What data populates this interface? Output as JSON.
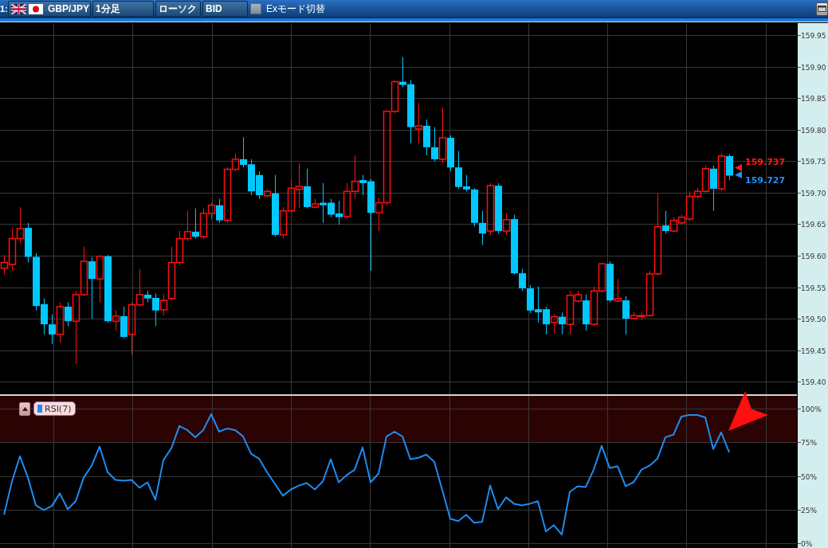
{
  "toolbar": {
    "pane_label": "1:",
    "selectors": [
      {
        "kind": "symbol",
        "label": "GBP/JPY"
      },
      {
        "kind": "plain",
        "label": "1分足"
      },
      {
        "kind": "plain",
        "label": "ローソク"
      },
      {
        "kind": "plain",
        "label": "BID"
      }
    ],
    "ex_mode": {
      "label": "Exモード切替",
      "checked": false
    }
  },
  "price_chart": {
    "chart_data": {
      "type": "candlestick",
      "grid": true,
      "ylim": [
        159.38,
        159.969
      ],
      "yticks": [
        {
          "value": 159.95,
          "label": "159.95"
        },
        {
          "value": 159.9,
          "label": "159.90"
        },
        {
          "value": 159.85,
          "label": "159.85"
        },
        {
          "value": 159.8,
          "label": "159.80"
        },
        {
          "value": 159.75,
          "label": "159.75"
        },
        {
          "value": 159.7,
          "label": "159.70"
        },
        {
          "value": 159.65,
          "label": "159.65"
        },
        {
          "value": 159.6,
          "label": "159.60"
        },
        {
          "value": 159.55,
          "label": "159.55"
        },
        {
          "value": 159.5,
          "label": "159.50"
        },
        {
          "value": 159.45,
          "label": "159.45"
        },
        {
          "value": 159.4,
          "label": "159.40"
        }
      ],
      "categories": [
        null,
        null,
        null,
        null,
        null,
        null,
        null,
        null,
        null,
        null,
        null,
        null,
        null,
        null,
        null,
        null,
        null,
        null,
        null,
        null,
        null,
        null,
        null,
        null,
        null,
        null,
        null,
        null,
        null,
        null,
        null,
        null,
        null,
        null,
        null,
        null,
        null,
        null,
        null,
        null,
        null,
        null,
        null,
        null,
        null,
        null,
        null,
        null,
        null,
        null,
        null,
        null,
        null,
        null,
        null,
        null,
        null,
        null,
        null,
        null,
        null,
        null,
        null,
        null,
        null,
        null,
        null,
        null,
        null,
        null,
        null,
        null,
        null,
        null,
        null,
        null,
        null,
        null,
        null,
        null,
        null,
        null,
        null,
        null,
        null,
        null,
        null,
        null,
        null,
        null,
        null,
        null,
        null,
        null,
        null,
        null,
        null,
        null,
        null,
        null
      ],
      "ohlc": [
        [
          159.58,
          159.601,
          159.57,
          159.589
        ],
        [
          159.586,
          159.642,
          159.576,
          159.627
        ],
        [
          159.627,
          159.677,
          159.62,
          159.643
        ],
        [
          159.644,
          159.652,
          159.589,
          159.598
        ],
        [
          159.598,
          159.604,
          159.513,
          159.52
        ],
        [
          159.523,
          159.532,
          159.475,
          159.491
        ],
        [
          159.491,
          159.507,
          159.46,
          159.475
        ],
        [
          159.475,
          159.526,
          159.462,
          159.519
        ],
        [
          159.519,
          159.526,
          159.488,
          159.496
        ],
        [
          159.496,
          159.544,
          159.428,
          159.538
        ],
        [
          159.538,
          159.614,
          159.536,
          159.591
        ],
        [
          159.591,
          159.598,
          159.5,
          159.563
        ],
        [
          159.563,
          159.601,
          159.526,
          159.599
        ],
        [
          159.599,
          159.601,
          159.494,
          159.496
        ],
        [
          159.496,
          159.513,
          159.481,
          159.504
        ],
        [
          159.504,
          159.519,
          159.469,
          159.471
        ],
        [
          159.475,
          159.526,
          159.443,
          159.522
        ],
        [
          159.522,
          159.579,
          159.519,
          159.538
        ],
        [
          159.538,
          159.544,
          159.526,
          159.532
        ],
        [
          159.533,
          159.54,
          159.488,
          159.513
        ],
        [
          159.514,
          159.539,
          159.505,
          159.529
        ],
        [
          159.532,
          159.614,
          159.529,
          159.589
        ],
        [
          159.589,
          159.639,
          159.585,
          159.627
        ],
        [
          159.627,
          159.671,
          159.623,
          159.638
        ],
        [
          159.638,
          159.675,
          159.627,
          159.63
        ],
        [
          159.63,
          159.675,
          159.627,
          159.667
        ],
        [
          159.667,
          159.684,
          159.658,
          159.68
        ],
        [
          159.68,
          159.69,
          159.652,
          159.656
        ],
        [
          159.656,
          159.74,
          159.652,
          159.737
        ],
        [
          159.737,
          159.762,
          159.734,
          159.753
        ],
        [
          159.753,
          159.788,
          159.74,
          159.744
        ],
        [
          159.745,
          159.753,
          159.696,
          159.702
        ],
        [
          159.728,
          159.734,
          159.69,
          159.696
        ],
        [
          159.695,
          159.705,
          159.692,
          159.702
        ],
        [
          159.699,
          159.728,
          159.63,
          159.633
        ],
        [
          159.633,
          159.677,
          159.627,
          159.671
        ],
        [
          159.671,
          159.721,
          159.667,
          159.707
        ],
        [
          159.705,
          159.747,
          159.675,
          159.71
        ],
        [
          159.71,
          159.738,
          159.675,
          159.677
        ],
        [
          159.677,
          159.69,
          159.675,
          159.682
        ],
        [
          159.684,
          159.715,
          159.652,
          159.68
        ],
        [
          159.684,
          159.69,
          159.661,
          159.665
        ],
        [
          159.667,
          159.687,
          159.649,
          159.661
        ],
        [
          159.662,
          159.715,
          159.658,
          159.702
        ],
        [
          159.702,
          159.759,
          159.69,
          159.718
        ],
        [
          159.72,
          159.728,
          159.696,
          159.715
        ],
        [
          159.718,
          159.721,
          159.576,
          159.668
        ],
        [
          159.668,
          159.692,
          159.639,
          159.684
        ],
        [
          159.684,
          159.831,
          159.68,
          159.829
        ],
        [
          159.829,
          159.879,
          159.826,
          159.876
        ],
        [
          159.876,
          159.915,
          159.867,
          159.871
        ],
        [
          159.872,
          159.879,
          159.778,
          159.804
        ],
        [
          159.801,
          159.842,
          159.778,
          159.806
        ],
        [
          159.806,
          159.816,
          159.759,
          159.772
        ],
        [
          159.772,
          159.804,
          159.75,
          159.753
        ],
        [
          159.753,
          159.835,
          159.747,
          159.787
        ],
        [
          159.787,
          159.791,
          159.734,
          159.74
        ],
        [
          159.74,
          159.766,
          159.706,
          159.709
        ],
        [
          159.71,
          159.728,
          159.702,
          159.705
        ],
        [
          159.705,
          159.707,
          159.646,
          159.652
        ],
        [
          159.652,
          159.671,
          159.617,
          159.635
        ],
        [
          159.639,
          159.715,
          159.633,
          159.711
        ],
        [
          159.711,
          159.715,
          159.635,
          159.639
        ],
        [
          159.639,
          159.667,
          159.633,
          159.657
        ],
        [
          159.658,
          159.665,
          159.57,
          159.572
        ],
        [
          159.572,
          159.579,
          159.544,
          159.548
        ],
        [
          159.548,
          159.553,
          159.509,
          159.513
        ],
        [
          159.515,
          159.551,
          159.494,
          159.51
        ],
        [
          159.515,
          159.519,
          159.475,
          159.491
        ],
        [
          159.494,
          159.507,
          159.477,
          159.503
        ],
        [
          159.503,
          159.51,
          159.475,
          159.491
        ],
        [
          159.491,
          159.544,
          159.475,
          159.537
        ],
        [
          159.528,
          159.544,
          159.526,
          159.538
        ],
        [
          159.529,
          159.538,
          159.481,
          159.491
        ],
        [
          159.491,
          159.551,
          159.488,
          159.544
        ],
        [
          159.544,
          159.589,
          159.541,
          159.587
        ],
        [
          159.587,
          159.591,
          159.526,
          159.529
        ],
        [
          159.528,
          159.563,
          159.526,
          159.532
        ],
        [
          159.529,
          159.536,
          159.475,
          159.5
        ],
        [
          159.5,
          159.51,
          159.498,
          159.505
        ],
        [
          159.503,
          159.51,
          159.498,
          159.505
        ],
        [
          159.505,
          159.576,
          159.503,
          159.571
        ],
        [
          159.571,
          159.699,
          159.568,
          159.646
        ],
        [
          159.648,
          159.671,
          159.635,
          159.639
        ],
        [
          159.639,
          159.661,
          159.637,
          159.656
        ],
        [
          159.652,
          159.665,
          159.649,
          159.661
        ],
        [
          159.658,
          159.702,
          159.654,
          159.694
        ],
        [
          159.694,
          159.707,
          159.69,
          159.702
        ],
        [
          159.702,
          159.743,
          159.7,
          159.738
        ],
        [
          159.738,
          159.743,
          159.671,
          159.706
        ],
        [
          159.706,
          159.763,
          159.702,
          159.758
        ],
        [
          159.758,
          159.761,
          159.72,
          159.727
        ],
        null,
        null,
        null,
        null,
        null,
        null,
        null,
        null
      ]
    },
    "price_markers": [
      {
        "label": "159.737",
        "color": "#ff1a1a"
      },
      {
        "label": "159.727",
        "color": "#1e90ff"
      }
    ]
  },
  "rsi_panel": {
    "chart_data": {
      "type": "line",
      "grid": true,
      "ylim": [
        -3.5,
        109.5
      ],
      "yticks": [
        {
          "value": 100,
          "label": "100%"
        },
        {
          "value": 75,
          "label": "75%"
        },
        {
          "value": 50,
          "label": "50%"
        },
        {
          "value": 25,
          "label": "25%"
        },
        {
          "value": 0,
          "label": "0%"
        }
      ],
      "categories": [
        null,
        null,
        null,
        null,
        null,
        null,
        null,
        null,
        null,
        null,
        null,
        null,
        null,
        null,
        null,
        null,
        null,
        null,
        null,
        null,
        null,
        null,
        null,
        null,
        null,
        null,
        null,
        null,
        null,
        null,
        null,
        null,
        null,
        null,
        null,
        null,
        null,
        null,
        null,
        null,
        null,
        null,
        null,
        null,
        null,
        null,
        null,
        null,
        null,
        null,
        null,
        null,
        null,
        null,
        null,
        null,
        null,
        null,
        null,
        null,
        null,
        null,
        null,
        null,
        null,
        null,
        null,
        null,
        null,
        null,
        null,
        null,
        null,
        null,
        null,
        null,
        null,
        null,
        null,
        null,
        null,
        null,
        null,
        null,
        null,
        null,
        null,
        null,
        null,
        null,
        null,
        null,
        null,
        null,
        null,
        null,
        null,
        null,
        null,
        null
      ],
      "series": [
        {
          "name": "RSI(7)",
          "color": "#1e8cf0",
          "values": [
            21.2,
            45.9,
            64.7,
            48.8,
            28.2,
            24.7,
            27.6,
            37.1,
            25.3,
            31.2,
            48.8,
            57.6,
            71.8,
            52.9,
            47.1,
            46.5,
            47.1,
            41.2,
            45.3,
            32.4,
            61.8,
            70.6,
            87.1,
            84.1,
            78.8,
            84.1,
            95.9,
            82.9,
            85.3,
            84.1,
            79.4,
            66.5,
            62.9,
            52.9,
            44.1,
            35.3,
            40.0,
            42.9,
            44.7,
            40.0,
            45.9,
            62.4,
            45.3,
            50.6,
            54.7,
            71.2,
            45.3,
            51.8,
            79.4,
            82.9,
            79.4,
            62.4,
            63.5,
            65.9,
            60.6,
            39.4,
            18.2,
            16.5,
            21.2,
            15.3,
            15.9,
            42.9,
            25.3,
            34.1,
            29.4,
            28.2,
            29.4,
            31.2,
            8.8,
            13.5,
            6.5,
            38.2,
            42.4,
            41.8,
            54.7,
            72.4,
            55.9,
            57.1,
            42.4,
            45.3,
            54.7,
            57.6,
            62.9,
            78.8,
            80.6,
            94.1,
            95.3,
            95.3,
            93.5,
            70.0,
            82.4,
            67.6,
            null,
            null,
            null,
            null,
            null,
            null,
            null,
            null
          ]
        }
      ],
      "bands": [
        {
          "axis": "y",
          "from": 75,
          "to": 109.5
        }
      ]
    }
  }
}
